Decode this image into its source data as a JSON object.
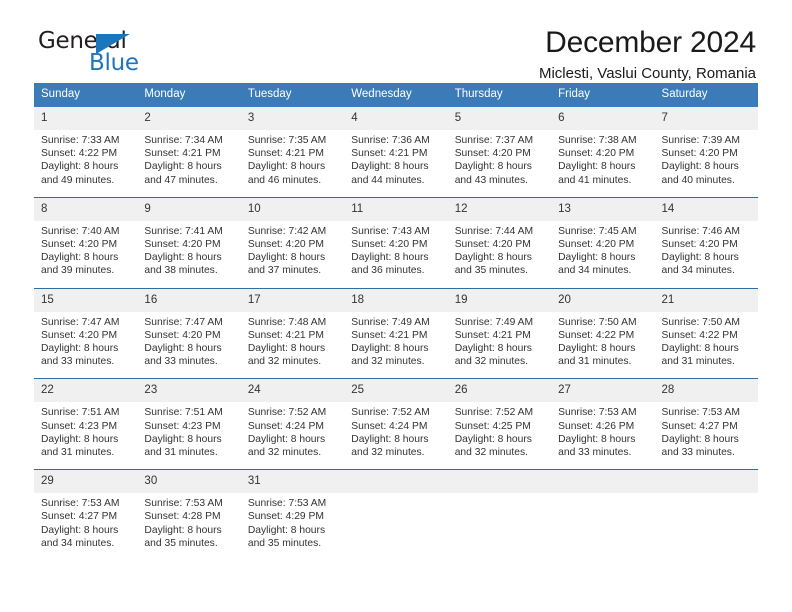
{
  "brand": {
    "name_part1": "General",
    "name_part2": "Blue",
    "triangle_icon": "brand-triangle-icon",
    "accent_color": "#1d76bc"
  },
  "header": {
    "title": "December 2024",
    "subtitle": "Miclesti, Vaslui County, Romania"
  },
  "calendar": {
    "header_bg": "#3b7cb8",
    "daynum_bg": "#f0f0f0",
    "row_border": "#2f6da8",
    "weekday_headers": [
      "Sunday",
      "Monday",
      "Tuesday",
      "Wednesday",
      "Thursday",
      "Friday",
      "Saturday"
    ],
    "weeks": [
      [
        {
          "day": "1",
          "sunrise": "Sunrise: 7:33 AM",
          "sunset": "Sunset: 4:22 PM",
          "daylight_line1": "Daylight: 8 hours",
          "daylight_line2": "and 49 minutes."
        },
        {
          "day": "2",
          "sunrise": "Sunrise: 7:34 AM",
          "sunset": "Sunset: 4:21 PM",
          "daylight_line1": "Daylight: 8 hours",
          "daylight_line2": "and 47 minutes."
        },
        {
          "day": "3",
          "sunrise": "Sunrise: 7:35 AM",
          "sunset": "Sunset: 4:21 PM",
          "daylight_line1": "Daylight: 8 hours",
          "daylight_line2": "and 46 minutes."
        },
        {
          "day": "4",
          "sunrise": "Sunrise: 7:36 AM",
          "sunset": "Sunset: 4:21 PM",
          "daylight_line1": "Daylight: 8 hours",
          "daylight_line2": "and 44 minutes."
        },
        {
          "day": "5",
          "sunrise": "Sunrise: 7:37 AM",
          "sunset": "Sunset: 4:20 PM",
          "daylight_line1": "Daylight: 8 hours",
          "daylight_line2": "and 43 minutes."
        },
        {
          "day": "6",
          "sunrise": "Sunrise: 7:38 AM",
          "sunset": "Sunset: 4:20 PM",
          "daylight_line1": "Daylight: 8 hours",
          "daylight_line2": "and 41 minutes."
        },
        {
          "day": "7",
          "sunrise": "Sunrise: 7:39 AM",
          "sunset": "Sunset: 4:20 PM",
          "daylight_line1": "Daylight: 8 hours",
          "daylight_line2": "and 40 minutes."
        }
      ],
      [
        {
          "day": "8",
          "sunrise": "Sunrise: 7:40 AM",
          "sunset": "Sunset: 4:20 PM",
          "daylight_line1": "Daylight: 8 hours",
          "daylight_line2": "and 39 minutes."
        },
        {
          "day": "9",
          "sunrise": "Sunrise: 7:41 AM",
          "sunset": "Sunset: 4:20 PM",
          "daylight_line1": "Daylight: 8 hours",
          "daylight_line2": "and 38 minutes."
        },
        {
          "day": "10",
          "sunrise": "Sunrise: 7:42 AM",
          "sunset": "Sunset: 4:20 PM",
          "daylight_line1": "Daylight: 8 hours",
          "daylight_line2": "and 37 minutes."
        },
        {
          "day": "11",
          "sunrise": "Sunrise: 7:43 AM",
          "sunset": "Sunset: 4:20 PM",
          "daylight_line1": "Daylight: 8 hours",
          "daylight_line2": "and 36 minutes."
        },
        {
          "day": "12",
          "sunrise": "Sunrise: 7:44 AM",
          "sunset": "Sunset: 4:20 PM",
          "daylight_line1": "Daylight: 8 hours",
          "daylight_line2": "and 35 minutes."
        },
        {
          "day": "13",
          "sunrise": "Sunrise: 7:45 AM",
          "sunset": "Sunset: 4:20 PM",
          "daylight_line1": "Daylight: 8 hours",
          "daylight_line2": "and 34 minutes."
        },
        {
          "day": "14",
          "sunrise": "Sunrise: 7:46 AM",
          "sunset": "Sunset: 4:20 PM",
          "daylight_line1": "Daylight: 8 hours",
          "daylight_line2": "and 34 minutes."
        }
      ],
      [
        {
          "day": "15",
          "sunrise": "Sunrise: 7:47 AM",
          "sunset": "Sunset: 4:20 PM",
          "daylight_line1": "Daylight: 8 hours",
          "daylight_line2": "and 33 minutes."
        },
        {
          "day": "16",
          "sunrise": "Sunrise: 7:47 AM",
          "sunset": "Sunset: 4:20 PM",
          "daylight_line1": "Daylight: 8 hours",
          "daylight_line2": "and 33 minutes."
        },
        {
          "day": "17",
          "sunrise": "Sunrise: 7:48 AM",
          "sunset": "Sunset: 4:21 PM",
          "daylight_line1": "Daylight: 8 hours",
          "daylight_line2": "and 32 minutes."
        },
        {
          "day": "18",
          "sunrise": "Sunrise: 7:49 AM",
          "sunset": "Sunset: 4:21 PM",
          "daylight_line1": "Daylight: 8 hours",
          "daylight_line2": "and 32 minutes."
        },
        {
          "day": "19",
          "sunrise": "Sunrise: 7:49 AM",
          "sunset": "Sunset: 4:21 PM",
          "daylight_line1": "Daylight: 8 hours",
          "daylight_line2": "and 32 minutes."
        },
        {
          "day": "20",
          "sunrise": "Sunrise: 7:50 AM",
          "sunset": "Sunset: 4:22 PM",
          "daylight_line1": "Daylight: 8 hours",
          "daylight_line2": "and 31 minutes."
        },
        {
          "day": "21",
          "sunrise": "Sunrise: 7:50 AM",
          "sunset": "Sunset: 4:22 PM",
          "daylight_line1": "Daylight: 8 hours",
          "daylight_line2": "and 31 minutes."
        }
      ],
      [
        {
          "day": "22",
          "sunrise": "Sunrise: 7:51 AM",
          "sunset": "Sunset: 4:23 PM",
          "daylight_line1": "Daylight: 8 hours",
          "daylight_line2": "and 31 minutes."
        },
        {
          "day": "23",
          "sunrise": "Sunrise: 7:51 AM",
          "sunset": "Sunset: 4:23 PM",
          "daylight_line1": "Daylight: 8 hours",
          "daylight_line2": "and 31 minutes."
        },
        {
          "day": "24",
          "sunrise": "Sunrise: 7:52 AM",
          "sunset": "Sunset: 4:24 PM",
          "daylight_line1": "Daylight: 8 hours",
          "daylight_line2": "and 32 minutes."
        },
        {
          "day": "25",
          "sunrise": "Sunrise: 7:52 AM",
          "sunset": "Sunset: 4:24 PM",
          "daylight_line1": "Daylight: 8 hours",
          "daylight_line2": "and 32 minutes."
        },
        {
          "day": "26",
          "sunrise": "Sunrise: 7:52 AM",
          "sunset": "Sunset: 4:25 PM",
          "daylight_line1": "Daylight: 8 hours",
          "daylight_line2": "and 32 minutes."
        },
        {
          "day": "27",
          "sunrise": "Sunrise: 7:53 AM",
          "sunset": "Sunset: 4:26 PM",
          "daylight_line1": "Daylight: 8 hours",
          "daylight_line2": "and 33 minutes."
        },
        {
          "day": "28",
          "sunrise": "Sunrise: 7:53 AM",
          "sunset": "Sunset: 4:27 PM",
          "daylight_line1": "Daylight: 8 hours",
          "daylight_line2": "and 33 minutes."
        }
      ],
      [
        {
          "day": "29",
          "sunrise": "Sunrise: 7:53 AM",
          "sunset": "Sunset: 4:27 PM",
          "daylight_line1": "Daylight: 8 hours",
          "daylight_line2": "and 34 minutes."
        },
        {
          "day": "30",
          "sunrise": "Sunrise: 7:53 AM",
          "sunset": "Sunset: 4:28 PM",
          "daylight_line1": "Daylight: 8 hours",
          "daylight_line2": "and 35 minutes."
        },
        {
          "day": "31",
          "sunrise": "Sunrise: 7:53 AM",
          "sunset": "Sunset: 4:29 PM",
          "daylight_line1": "Daylight: 8 hours",
          "daylight_line2": "and 35 minutes."
        },
        {
          "day": "",
          "sunrise": "",
          "sunset": "",
          "daylight_line1": "",
          "daylight_line2": ""
        },
        {
          "day": "",
          "sunrise": "",
          "sunset": "",
          "daylight_line1": "",
          "daylight_line2": ""
        },
        {
          "day": "",
          "sunrise": "",
          "sunset": "",
          "daylight_line1": "",
          "daylight_line2": ""
        },
        {
          "day": "",
          "sunrise": "",
          "sunset": "",
          "daylight_line1": "",
          "daylight_line2": ""
        }
      ]
    ]
  }
}
